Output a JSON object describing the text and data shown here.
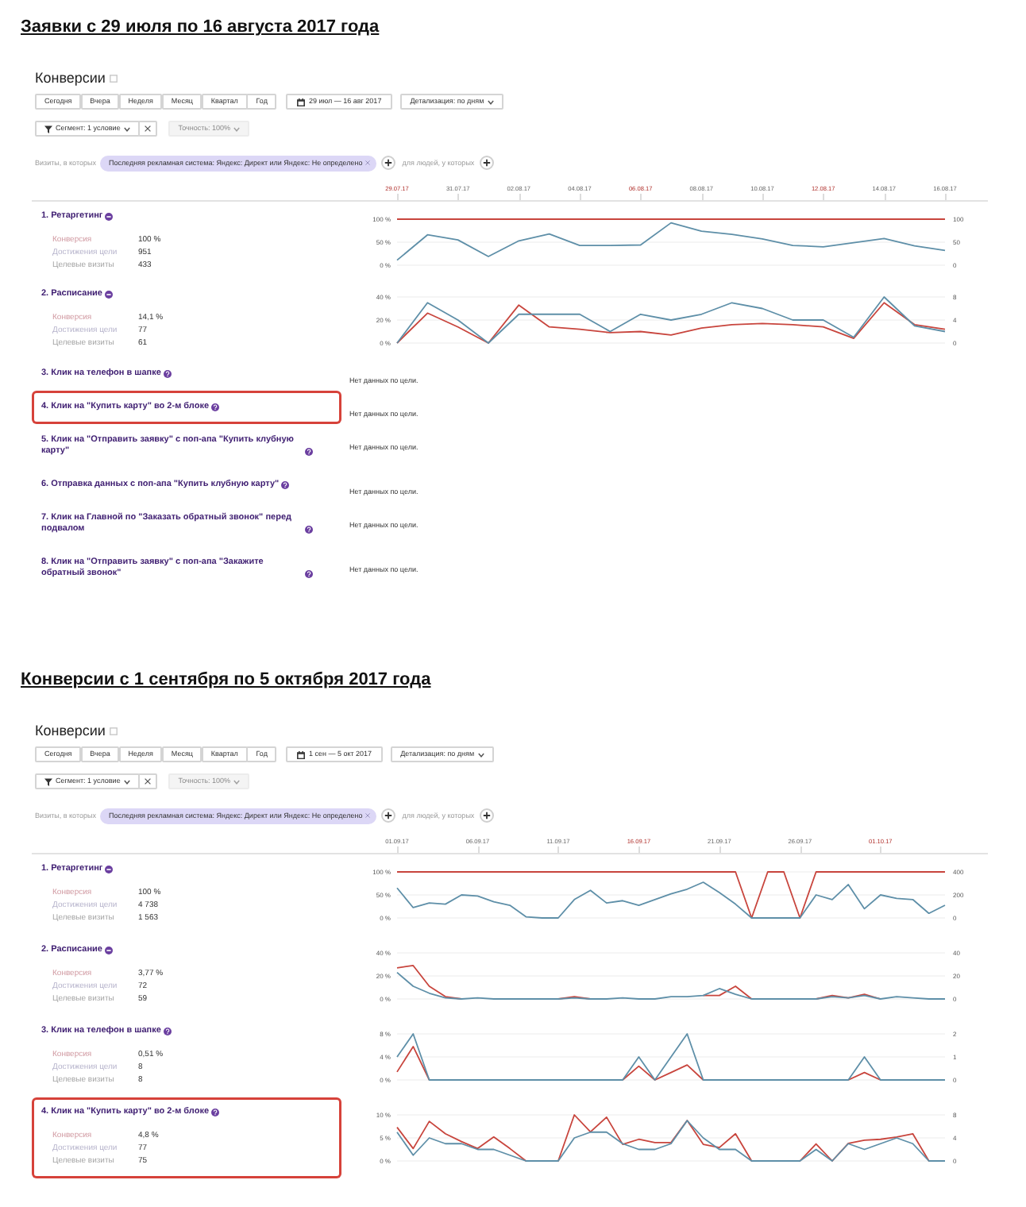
{
  "sections": [
    {
      "heading": "Заявки с 29 июля по 16 августа 2017 года",
      "report": {
        "title": "Конверсии",
        "periods": [
          {
            "label": "Сегодня",
            "selected": false
          },
          {
            "label": "Вчера",
            "selected": false
          },
          {
            "label": "Неделя",
            "selected": false
          },
          {
            "label": "Месяц",
            "selected": false
          },
          {
            "label": "Квартал",
            "selected": false
          },
          {
            "label": "Год",
            "selected": false
          }
        ],
        "date_range": "29 июл — 16 авг 2017",
        "detail": "Детализация: по дням",
        "segment": "Сегмент: 1 условие",
        "accuracy": {
          "label": "Точность: 100%",
          "disabled": true
        },
        "filter": {
          "label": "Визиты, в которых",
          "chip": "Последняя рекламная система: Яндекс: Директ или Яндекс: Не определено",
          "people_label": "для людей, у которых"
        },
        "date_axis": [
          {
            "label": "29.07.17",
            "weekend": true
          },
          {
            "label": "31.07.17",
            "weekend": false
          },
          {
            "label": "02.08.17",
            "weekend": false
          },
          {
            "label": "04.08.17",
            "weekend": false
          },
          {
            "label": "06.08.17",
            "weekend": true
          },
          {
            "label": "08.08.17",
            "weekend": false
          },
          {
            "label": "10.08.17",
            "weekend": false
          },
          {
            "label": "12.08.17",
            "weekend": true
          },
          {
            "label": "14.08.17",
            "weekend": false
          },
          {
            "label": "16.08.17",
            "weekend": false
          }
        ],
        "goals": [
          {
            "title": "1. Ретаргетинг",
            "kind": "minus",
            "highlighted": false,
            "stats": [
              {
                "label": "Конверсия",
                "value": "100 %"
              },
              {
                "label": "Достижения цели",
                "value": "951"
              },
              {
                "label": "Целевые визиты",
                "value": "433"
              }
            ],
            "chart_data": {
              "type": "line",
              "ylim": [
                0,
                100
              ],
              "yticks": [
                {
                  "value": 0,
                  "label": "0 %"
                },
                {
                  "value": 50,
                  "label": "50 %"
                },
                {
                  "value": 100,
                  "label": "100 %"
                }
              ],
              "y2lim": [
                0,
                100
              ],
              "y2ticks": [
                0,
                50,
                100
              ],
              "series": [
                {
                  "color": "#c8453d",
                  "values": [
                    100,
                    100,
                    100,
                    100,
                    100,
                    100,
                    100,
                    100,
                    100,
                    100,
                    100,
                    100,
                    100,
                    100,
                    100,
                    100,
                    100,
                    100,
                    100
                  ]
                },
                {
                  "color": "#5e8fa8",
                  "axis": "y2",
                  "values": [
                    11,
                    66,
                    55,
                    19,
                    53,
                    68,
                    43,
                    43,
                    44,
                    92,
                    74,
                    67,
                    57,
                    43,
                    40,
                    49,
                    58,
                    42,
                    32
                  ]
                }
              ]
            }
          },
          {
            "title": "2. Расписание",
            "kind": "minus",
            "highlighted": false,
            "stats": [
              {
                "label": "Конверсия",
                "value": "14,1 %"
              },
              {
                "label": "Достижения цели",
                "value": "77"
              },
              {
                "label": "Целевые визиты",
                "value": "61"
              }
            ],
            "chart_data": {
              "type": "line",
              "ylim": [
                0,
                40
              ],
              "yticks": [
                {
                  "value": 0,
                  "label": "0 %"
                },
                {
                  "value": 20,
                  "label": "20 %"
                },
                {
                  "value": 40,
                  "label": "40 %"
                }
              ],
              "y2lim": [
                0,
                8
              ],
              "y2ticks": [
                0,
                4,
                8
              ],
              "series": [
                {
                  "color": "#c8453d",
                  "values": [
                    0,
                    26,
                    14,
                    0,
                    33,
                    14,
                    12,
                    9,
                    10,
                    7,
                    13,
                    16,
                    17,
                    16,
                    14,
                    4,
                    35,
                    16,
                    12
                  ]
                },
                {
                  "color": "#5e8fa8",
                  "axis": "y2",
                  "values": [
                    0,
                    7,
                    4,
                    0,
                    5,
                    5,
                    5,
                    2,
                    5,
                    4,
                    5,
                    7,
                    6,
                    4,
                    4,
                    1,
                    8,
                    3,
                    2
                  ]
                }
              ]
            }
          },
          {
            "title": "3. Клик на телефон в шапке",
            "kind": "question",
            "highlighted": false,
            "no_data": "Нет данных по цели."
          },
          {
            "title": "4. Клик на \"Купить карту\" во 2-м блоке",
            "kind": "question",
            "highlighted": true,
            "no_data": "Нет данных по цели."
          },
          {
            "title": "5. Клик на \"Отправить заявку\" с поп-апа \"Купить клубную карту\"",
            "kind": "question",
            "highlighted": false,
            "no_data": "Нет данных по цели."
          },
          {
            "title": "6. Отправка данных с поп-апа \"Купить клубную карту\"",
            "kind": "question",
            "highlighted": false,
            "no_data": "Нет данных по цели."
          },
          {
            "title": "7. Клик на Главной по \"Заказать обратный звонок\" перед подвалом",
            "kind": "question",
            "highlighted": false,
            "no_data": "Нет данных по цели."
          },
          {
            "title": "8. Клик на \"Отправить заявку\" с поп-апа \"Закажите обратный звонок\"",
            "kind": "question",
            "highlighted": false,
            "no_data": "Нет данных по цели."
          }
        ]
      }
    },
    {
      "heading": "Конверсии с 1 сентября по 5 октября 2017 года",
      "report": {
        "title": "Конверсии",
        "periods": [
          {
            "label": "Сегодня",
            "selected": false
          },
          {
            "label": "Вчера",
            "selected": false
          },
          {
            "label": "Неделя",
            "selected": false
          },
          {
            "label": "Месяц",
            "selected": false
          },
          {
            "label": "Квартал",
            "selected": false
          },
          {
            "label": "Год",
            "selected": false
          }
        ],
        "date_range": "1 сен — 5 окт 2017",
        "detail": "Детализация: по дням",
        "segment": "Сегмент: 1 условие",
        "accuracy": {
          "label": "Точность: 100%",
          "disabled": true
        },
        "filter": {
          "label": "Визиты, в которых",
          "chip": "Последняя рекламная система: Яндекс: Директ или Яндекс: Не определено",
          "people_label": "для людей, у которых"
        },
        "date_axis": [
          {
            "label": "01.09.17",
            "weekend": false
          },
          {
            "label": "06.09.17",
            "weekend": false
          },
          {
            "label": "11.09.17",
            "weekend": false
          },
          {
            "label": "16.09.17",
            "weekend": true
          },
          {
            "label": "21.09.17",
            "weekend": false
          },
          {
            "label": "26.09.17",
            "weekend": false
          },
          {
            "label": "01.10.17",
            "weekend": true
          }
        ],
        "goals": [
          {
            "title": "1. Ретаргетинг",
            "kind": "minus",
            "highlighted": false,
            "stats": [
              {
                "label": "Конверсия",
                "value": "100 %"
              },
              {
                "label": "Достижения цели",
                "value": "4 738"
              },
              {
                "label": "Целевые визиты",
                "value": "1 563"
              }
            ],
            "chart_data": {
              "type": "line",
              "ylim": [
                0,
                100
              ],
              "yticks": [
                {
                  "value": 0,
                  "label": "0 %"
                },
                {
                  "value": 50,
                  "label": "50 %"
                },
                {
                  "value": 100,
                  "label": "100 %"
                }
              ],
              "y2lim": [
                0,
                400
              ],
              "y2ticks": [
                0,
                200,
                400
              ],
              "series": [
                {
                  "color": "#c8453d",
                  "values": [
                    100,
                    100,
                    100,
                    100,
                    100,
                    100,
                    100,
                    100,
                    100,
                    100,
                    100,
                    100,
                    100,
                    100,
                    100,
                    100,
                    100,
                    100,
                    100,
                    100,
                    100,
                    100,
                    0,
                    100,
                    100,
                    0,
                    100,
                    100,
                    100,
                    100,
                    100,
                    100,
                    100,
                    100,
                    100
                  ]
                },
                {
                  "color": "#5e8fa8",
                  "axis": "y2",
                  "values": [
                    260,
                    90,
                    130,
                    120,
                    200,
                    190,
                    140,
                    110,
                    10,
                    0,
                    0,
                    160,
                    240,
                    130,
                    150,
                    110,
                    160,
                    210,
                    250,
                    310,
                    220,
                    120,
                    0,
                    0,
                    0,
                    0,
                    200,
                    160,
                    290,
                    80,
                    200,
                    170,
                    160,
                    40,
                    110
                  ]
                }
              ]
            }
          },
          {
            "title": "2. Расписание",
            "kind": "minus",
            "highlighted": false,
            "stats": [
              {
                "label": "Конверсия",
                "value": "3,77 %"
              },
              {
                "label": "Достижения цели",
                "value": "72"
              },
              {
                "label": "Целевые визиты",
                "value": "59"
              }
            ],
            "chart_data": {
              "type": "line",
              "ylim": [
                0,
                40
              ],
              "yticks": [
                {
                  "value": 0,
                  "label": "0 %"
                },
                {
                  "value": 20,
                  "label": "20 %"
                },
                {
                  "value": 40,
                  "label": "40 %"
                }
              ],
              "y2lim": [
                0,
                40
              ],
              "y2ticks": [
                0,
                20,
                40
              ],
              "series": [
                {
                  "color": "#c8453d",
                  "values": [
                    27,
                    29,
                    11,
                    2,
                    0,
                    null,
                    null,
                    null,
                    null,
                    null,
                    0,
                    2,
                    0,
                    null,
                    null,
                    null,
                    null,
                    null,
                    null,
                    3,
                    3,
                    11,
                    0,
                    null,
                    null,
                    null,
                    0,
                    3,
                    1,
                    4,
                    0,
                    null,
                    null,
                    null,
                    null
                  ]
                },
                {
                  "color": "#5e8fa8",
                  "axis": "y2",
                  "values": [
                    23,
                    11,
                    5,
                    1,
                    0,
                    1,
                    0,
                    0,
                    0,
                    0,
                    0,
                    1,
                    0,
                    0,
                    1,
                    0,
                    0,
                    2,
                    2,
                    3,
                    9,
                    4,
                    0,
                    0,
                    0,
                    0,
                    0,
                    2,
                    1,
                    3,
                    0,
                    2,
                    1,
                    0,
                    0
                  ]
                }
              ]
            }
          },
          {
            "title": "3. Клик на телефон в шапке",
            "kind": "question",
            "highlighted": false,
            "stats": [
              {
                "label": "Конверсия",
                "value": "0,51 %"
              },
              {
                "label": "Достижения цели",
                "value": "8"
              },
              {
                "label": "Целевые визиты",
                "value": "8"
              }
            ],
            "chart_data": {
              "type": "line",
              "ylim": [
                0,
                8
              ],
              "yticks": [
                {
                  "value": 0,
                  "label": "0 %"
                },
                {
                  "value": 4,
                  "label": "4 %"
                },
                {
                  "value": 8,
                  "label": "8 %"
                }
              ],
              "y2lim": [
                0,
                2
              ],
              "y2ticks": [
                0,
                1,
                2
              ],
              "series": [
                {
                  "color": "#c8453d",
                  "values": [
                    1.4,
                    5.8,
                    0,
                    null,
                    null,
                    null,
                    null,
                    null,
                    null,
                    null,
                    null,
                    null,
                    null,
                    null,
                    0,
                    2.4,
                    0,
                    1.3,
                    2.6,
                    0,
                    null,
                    null,
                    null,
                    null,
                    null,
                    null,
                    null,
                    null,
                    0,
                    1.3,
                    0,
                    null,
                    null,
                    null,
                    null
                  ]
                },
                {
                  "color": "#5e8fa8",
                  "axis": "y2",
                  "values": [
                    1,
                    2,
                    0,
                    0,
                    0,
                    0,
                    0,
                    0,
                    0,
                    0,
                    0,
                    0,
                    0,
                    0,
                    0,
                    1,
                    0,
                    1,
                    2,
                    0,
                    0,
                    0,
                    0,
                    0,
                    0,
                    0,
                    0,
                    0,
                    0,
                    1,
                    0,
                    0,
                    0,
                    0,
                    0
                  ]
                }
              ]
            }
          },
          {
            "title": "4. Клик на \"Купить карту\" во 2-м блоке",
            "kind": "question",
            "highlighted": true,
            "stats": [
              {
                "label": "Конверсия",
                "value": "4,8 %"
              },
              {
                "label": "Достижения цели",
                "value": "77"
              },
              {
                "label": "Целевые визиты",
                "value": "75"
              }
            ],
            "chart_data": {
              "type": "line",
              "ylim": [
                0,
                10
              ],
              "yticks": [
                {
                  "value": 0,
                  "label": "0 %"
                },
                {
                  "value": 5,
                  "label": "5 %"
                },
                {
                  "value": 10,
                  "label": "10 %"
                }
              ],
              "y2lim": [
                0,
                8
              ],
              "y2ticks": [
                0,
                4,
                8
              ],
              "series": [
                {
                  "color": "#c8453d",
                  "values": [
                    7.3,
                    2.7,
                    8.6,
                    5.9,
                    4.2,
                    2.7,
                    5.2,
                    2.7,
                    0,
                    0,
                    0,
                    10,
                    6.3,
                    9.5,
                    3.6,
                    4.7,
                    4,
                    4,
                    8.8,
                    3.6,
                    2.9,
                    5.9,
                    0,
                    0,
                    0,
                    0,
                    3.7,
                    0,
                    3.8,
                    4.5,
                    4.7,
                    5.2,
                    5.9,
                    0,
                    0
                  ]
                },
                {
                  "color": "#5e8fa8",
                  "axis": "y2",
                  "values": [
                    5,
                    1,
                    4,
                    3,
                    3,
                    2,
                    2,
                    1,
                    0,
                    0,
                    0,
                    4,
                    5,
                    5,
                    3,
                    2,
                    2,
                    3,
                    7,
                    4,
                    2,
                    2,
                    0,
                    0,
                    0,
                    0,
                    2,
                    0,
                    3,
                    2,
                    3,
                    4,
                    3,
                    0,
                    0
                  ]
                }
              ]
            }
          }
        ]
      }
    }
  ]
}
